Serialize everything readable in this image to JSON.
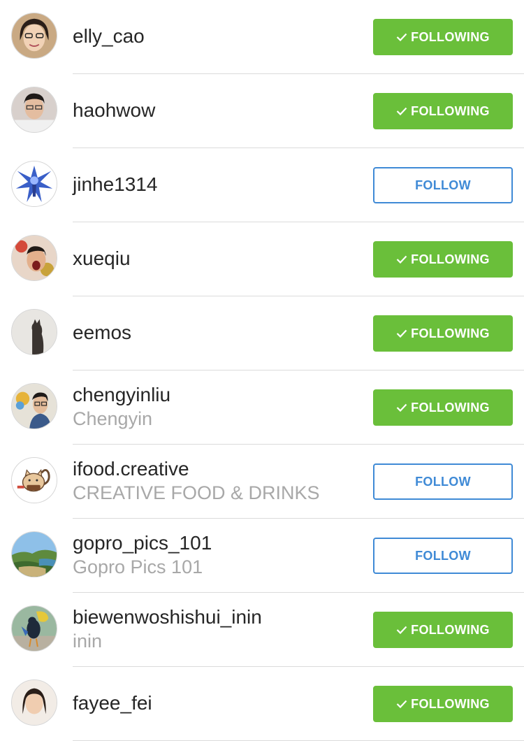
{
  "users": [
    {
      "username": "elly_cao",
      "fullname": "",
      "button": "FOLLOWING",
      "following": true,
      "avatar": "woman-glasses"
    },
    {
      "username": "haohwow",
      "fullname": "",
      "button": "FOLLOWING",
      "following": true,
      "avatar": "young-man"
    },
    {
      "username": "jinhe1314",
      "fullname": "",
      "button": "FOLLOW",
      "following": false,
      "avatar": "armored-figure"
    },
    {
      "username": "xueqiu",
      "fullname": "",
      "button": "FOLLOWING",
      "following": true,
      "avatar": "laughing-man"
    },
    {
      "username": "eemos",
      "fullname": "",
      "button": "FOLLOWING",
      "following": true,
      "avatar": "cat-silhouette"
    },
    {
      "username": "chengyinliu",
      "fullname": "Chengyin",
      "button": "FOLLOWING",
      "following": true,
      "avatar": "man-glasses"
    },
    {
      "username": "ifood.creative",
      "fullname": "CREATIVE FOOD & DRINKS",
      "button": "FOLLOW",
      "following": false,
      "avatar": "squirrel-logo"
    },
    {
      "username": "gopro_pics_101",
      "fullname": "Gopro Pics 101",
      "button": "FOLLOW",
      "following": false,
      "avatar": "landscape"
    },
    {
      "username": "biewenwoshishui_inin",
      "fullname": "inin",
      "button": "FOLLOWING",
      "following": true,
      "avatar": "bird"
    },
    {
      "username": "fayee_fei",
      "fullname": "",
      "button": "FOLLOWING",
      "following": true,
      "avatar": "woman"
    }
  ],
  "colors": {
    "following_bg": "#6abf3a",
    "follow_border": "#3f8ad6",
    "separator": "#dbdbdb"
  }
}
